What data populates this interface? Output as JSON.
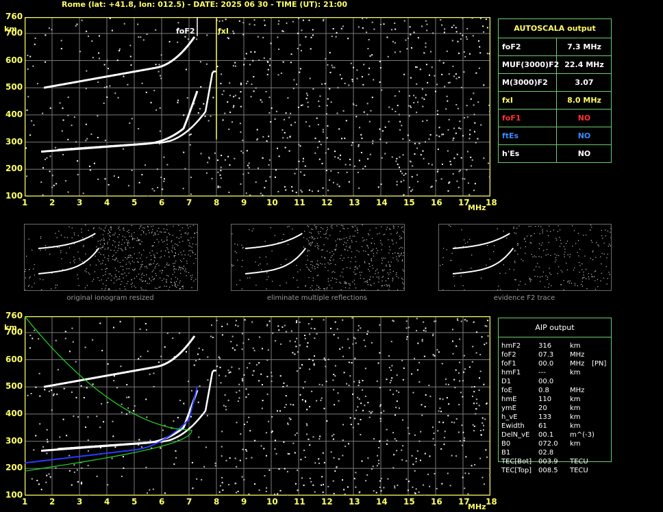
{
  "header": {
    "text": "Rome (lat: +41.8, lon: 012.5) - DATE: 2025 06 30 - TIME (UT): 21:00"
  },
  "axes": {
    "y_unit": "km",
    "x_unit": "MHz",
    "y_ticks": [
      "760",
      "700",
      "600",
      "500",
      "400",
      "300",
      "200",
      "100"
    ],
    "x_ticks": [
      "1",
      "2",
      "3",
      "4",
      "5",
      "6",
      "7",
      "8",
      "9",
      "10",
      "11",
      "12",
      "13",
      "14",
      "15",
      "16",
      "17",
      "18"
    ]
  },
  "ionogram_top": {
    "labels": {
      "foF2": "foF2",
      "fxI": "fxI"
    }
  },
  "autoscala": {
    "title": "AUTOSCALA output",
    "rows": [
      {
        "label": "foF2",
        "value": "7.3 MHz",
        "color": "#ffffff"
      },
      {
        "label": "MUF(3000)F2",
        "value": "22.4 MHz",
        "color": "#ffffff"
      },
      {
        "label": "M(3000)F2",
        "value": "3.07",
        "color": "#ffffff"
      },
      {
        "label": "fxI",
        "value": "8.0 MHz",
        "color": "#ffff66"
      },
      {
        "label": "foF1",
        "value": "NO",
        "color": "#ff3030"
      },
      {
        "label": "ftEs",
        "value": "NO",
        "color": "#3a8bff"
      },
      {
        "label": "h'Es",
        "value": "NO",
        "color": "#ffffff"
      }
    ]
  },
  "thumbnails": [
    {
      "caption": "original ionogram resized"
    },
    {
      "caption": "eliminate multiple reflections"
    },
    {
      "caption": "evidence F2 trace"
    }
  ],
  "aip": {
    "title": "AIP output",
    "rows": [
      {
        "name": "hmF2",
        "value": "316",
        "unit": "km",
        "extra": ""
      },
      {
        "name": "foF2",
        "value": "07.3",
        "unit": "MHz",
        "extra": ""
      },
      {
        "name": "foF1",
        "value": "00.0",
        "unit": "MHz",
        "extra": "[PN]"
      },
      {
        "name": "hmF1",
        "value": "---",
        "unit": "km",
        "extra": ""
      },
      {
        "name": "D1",
        "value": "00.0",
        "unit": "",
        "extra": ""
      },
      {
        "name": "foE",
        "value": "0.8",
        "unit": "MHz",
        "extra": ""
      },
      {
        "name": "hmE",
        "value": "110",
        "unit": "km",
        "extra": ""
      },
      {
        "name": "ymE",
        "value": "20",
        "unit": "km",
        "extra": ""
      },
      {
        "name": "h_vE",
        "value": "133",
        "unit": "km",
        "extra": ""
      },
      {
        "name": "Ewidth",
        "value": "61",
        "unit": "km",
        "extra": ""
      },
      {
        "name": "DelN_vE",
        "value": "00.1",
        "unit": "m^(-3)",
        "extra": ""
      },
      {
        "name": "B0",
        "value": "072.0",
        "unit": "km",
        "extra": ""
      },
      {
        "name": "B1",
        "value": "02.8",
        "unit": "",
        "extra": ""
      },
      {
        "name": "TEC[Bot]",
        "value": "003.9",
        "unit": "TECU",
        "extra": ""
      },
      {
        "name": "TEC[Top]",
        "value": "008.5",
        "unit": "TECU",
        "extra": ""
      }
    ]
  },
  "colors": {
    "grid": "#7a7a7a",
    "frame": "#ffff66",
    "trace": "#ffffff",
    "profile": "#2a3cff",
    "model": "#22dd22"
  }
}
